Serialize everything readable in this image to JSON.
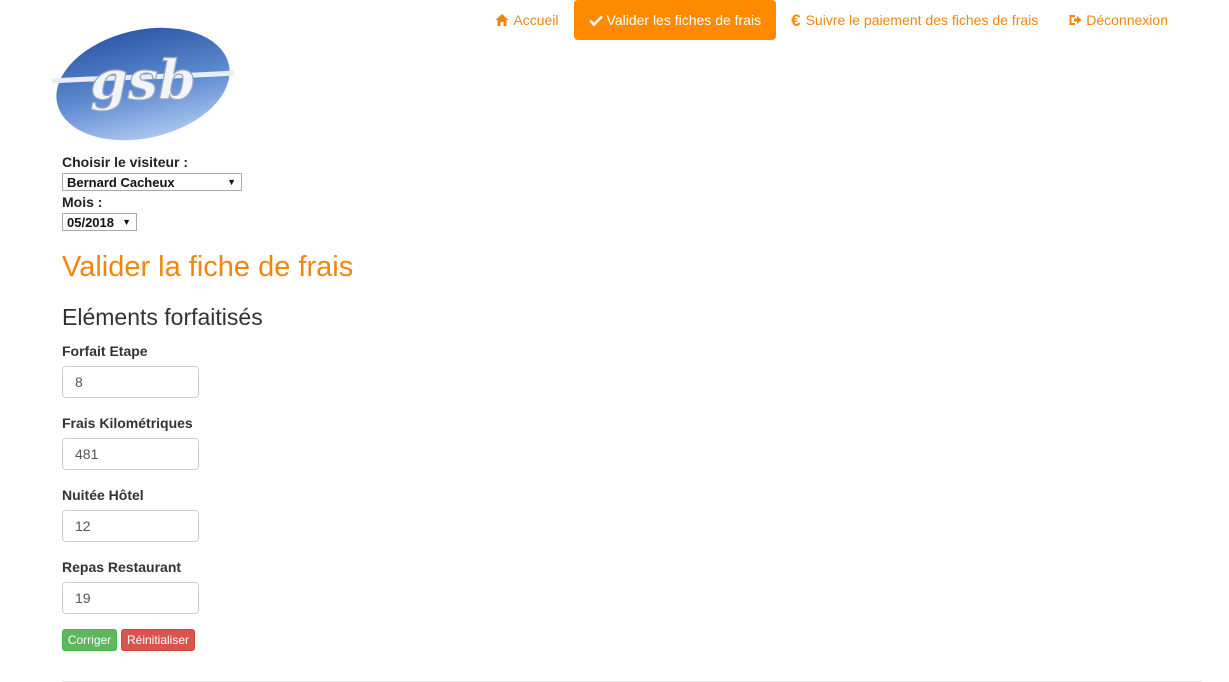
{
  "nav": {
    "items": [
      {
        "label": "Accueil",
        "icon": "home-icon",
        "active": false
      },
      {
        "label": "Valider les fiches de frais",
        "icon": "check-icon",
        "active": true
      },
      {
        "label": "Suivre le paiement des fiches de frais",
        "icon": "euro-icon",
        "active": false
      },
      {
        "label": "Déconnexion",
        "icon": "logout-icon",
        "active": false
      }
    ]
  },
  "logo": {
    "text": "gsb"
  },
  "visitor": {
    "label": "Choisir le visiteur :",
    "selected": "Bernard Cacheux"
  },
  "month": {
    "label": "Mois :",
    "selected": "05/2018"
  },
  "page_title": "Valider la fiche de frais",
  "section_title": "Eléments forfaitisés",
  "fields": [
    {
      "label": "Forfait Etape",
      "value": "8"
    },
    {
      "label": "Frais Kilométriques",
      "value": "481"
    },
    {
      "label": "Nuitée Hôtel",
      "value": "12"
    },
    {
      "label": "Repas Restaurant",
      "value": "19"
    }
  ],
  "buttons": {
    "correct": "Corriger",
    "reset": "Réinitialiser"
  },
  "colors": {
    "accent": "#f0860f",
    "active_nav": "#ff8a00",
    "success": "#5cb85c",
    "danger": "#d9534f"
  }
}
